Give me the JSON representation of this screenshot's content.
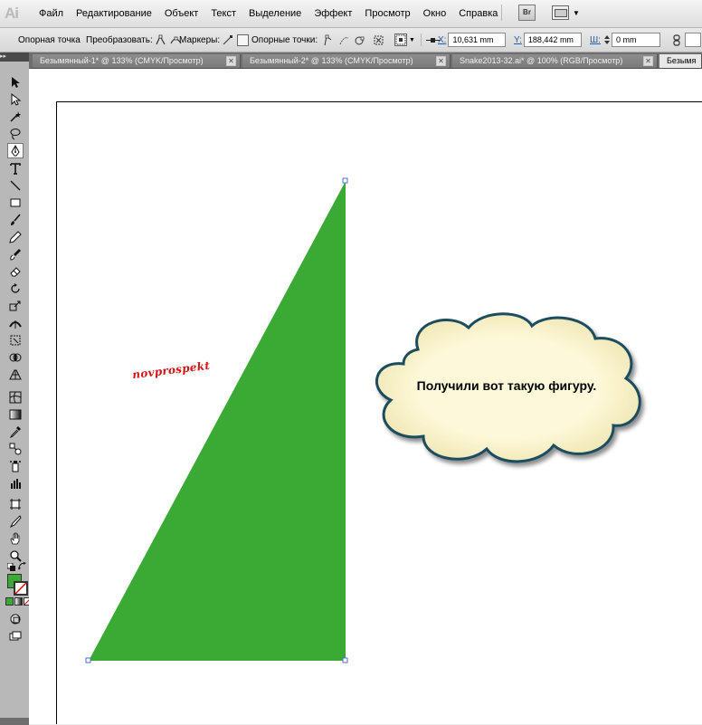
{
  "app": {
    "logo": "Ai"
  },
  "menu": [
    "Файл",
    "Редактирование",
    "Объект",
    "Текст",
    "Выделение",
    "Эффект",
    "Просмотр",
    "Окно",
    "Справка"
  ],
  "menu_tools": {
    "bridge_label": "Br"
  },
  "control_bar": {
    "anchor_point": "Опорная точка",
    "convert_label": "Преобразовать:",
    "handles_label": "Маркеры:",
    "anchors_label": "Опорные точки:",
    "x_label": "X:",
    "x_value": "10,631 mm",
    "y_label": "Y:",
    "y_value": "188,442 mm",
    "w_label": "Ш:",
    "w_value": "0 mm"
  },
  "tabs": [
    {
      "label": "Безымянный-1* @ 133% (CMYK/Просмотр)",
      "active": false
    },
    {
      "label": "Безымянный-2* @ 133% (CMYK/Просмотр)",
      "active": false
    },
    {
      "label": "Snake2013-32.ai* @ 100% (RGB/Просмотр)",
      "active": false
    },
    {
      "label": "Безымя",
      "active": true
    }
  ],
  "tools": [
    "selection-icon",
    "direct-selection-icon",
    "magic-wand-icon",
    "lasso-icon",
    "pen-icon",
    "type-icon",
    "line-icon",
    "rectangle-icon",
    "paintbrush-icon",
    "pencil-icon",
    "blob-brush-icon",
    "eraser-icon",
    "rotate-icon",
    "scale-icon",
    "width-icon",
    "free-transform-icon",
    "shape-builder-icon",
    "perspective-grid-icon",
    "mesh-icon",
    "gradient-icon",
    "eyedropper-icon",
    "blend-icon",
    "symbol-sprayer-icon",
    "column-graph-icon",
    "artboard-icon",
    "slice-icon",
    "hand-icon",
    "zoom-icon"
  ],
  "colors": {
    "fill": "#3aaa35",
    "stroke": "#ffffff",
    "triangle": "#3aaa35",
    "cloud_fill": "#fdf8d9",
    "cloud_stroke": "#1d4d5e",
    "watermark": "#d41414",
    "selection": "#4a6fd1"
  },
  "canvas": {
    "watermark": "novprospekt",
    "cloud_text": "Получили вот такую фигуру."
  }
}
